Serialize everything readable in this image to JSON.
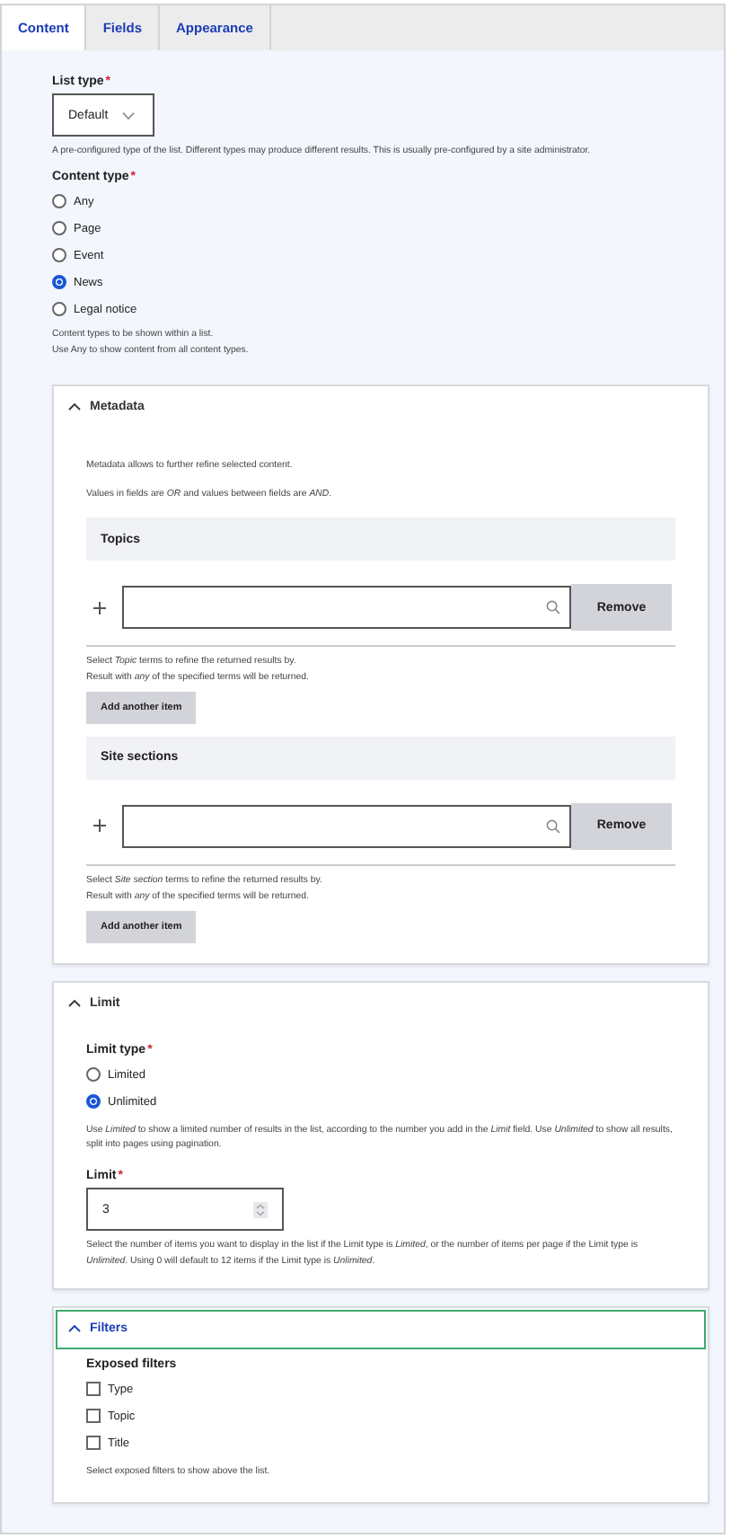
{
  "tabs": [
    {
      "label": "Content",
      "selected": true
    },
    {
      "label": "Fields",
      "selected": false
    },
    {
      "label": "Appearance",
      "selected": false
    }
  ],
  "list_type": {
    "label": "List type",
    "required_mark": "*",
    "value": "Default",
    "description": "A pre-configured type of the list. Different types may produce different results. This is usually pre-configured by a site administrator."
  },
  "content_type": {
    "label": "Content type",
    "required_mark": "*",
    "options": [
      {
        "label": "Any",
        "selected": false
      },
      {
        "label": "Page",
        "selected": false
      },
      {
        "label": "Event",
        "selected": false
      },
      {
        "label": "News",
        "selected": true
      },
      {
        "label": "Legal notice",
        "selected": false
      }
    ],
    "description": [
      "Content types to be shown within a list.",
      "Use Any to show content from all content types."
    ]
  },
  "metadata": {
    "title": "Metadata",
    "expanded": true,
    "intro": [
      "Metadata allows to further refine selected content.",
      "Values in fields are *OR* and values between fields are *AND*."
    ],
    "fields": [
      {
        "title": "Topics",
        "remove": "Remove",
        "description": [
          "Select *Topic* terms to refine the returned results by.",
          "Result with *any* of the specified terms will be returned."
        ],
        "add": "Add another item"
      },
      {
        "title": "Site sections",
        "remove": "Remove",
        "description": [
          "Select *Site section* terms to refine the returned results by.",
          "Result with *any* of the specified terms will be returned."
        ],
        "add": "Add another item"
      }
    ]
  },
  "limit": {
    "title": "Limit",
    "expanded": true,
    "type_label": "Limit type",
    "type_required_mark": "*",
    "options": [
      {
        "label": "Limited",
        "selected": false
      },
      {
        "label": "Unlimited",
        "selected": true
      }
    ],
    "type_description": "Use *Limited* to show a limited number of results in the list, according to the number you add in the *Limit* field. Use *Unlimited* to show all results, split into pages using pagination.",
    "limit_label": "Limit",
    "limit_required_mark": "*",
    "limit_value": "3",
    "limit_description": "Select the number of items you want to display in the list if the Limit type is *Limited*, or the number of items per page if the Limit type is *Unlimited*. Using 0 will default to 12 items if the Limit type is *Unlimited*."
  },
  "filters": {
    "title": "Filters",
    "expanded": true,
    "focused": true,
    "label": "Exposed filters",
    "options": [
      {
        "label": "Type",
        "checked": false
      },
      {
        "label": "Topic",
        "checked": false
      },
      {
        "label": "Title",
        "checked": false
      }
    ],
    "description": "Select exposed filters to show above the list."
  }
}
